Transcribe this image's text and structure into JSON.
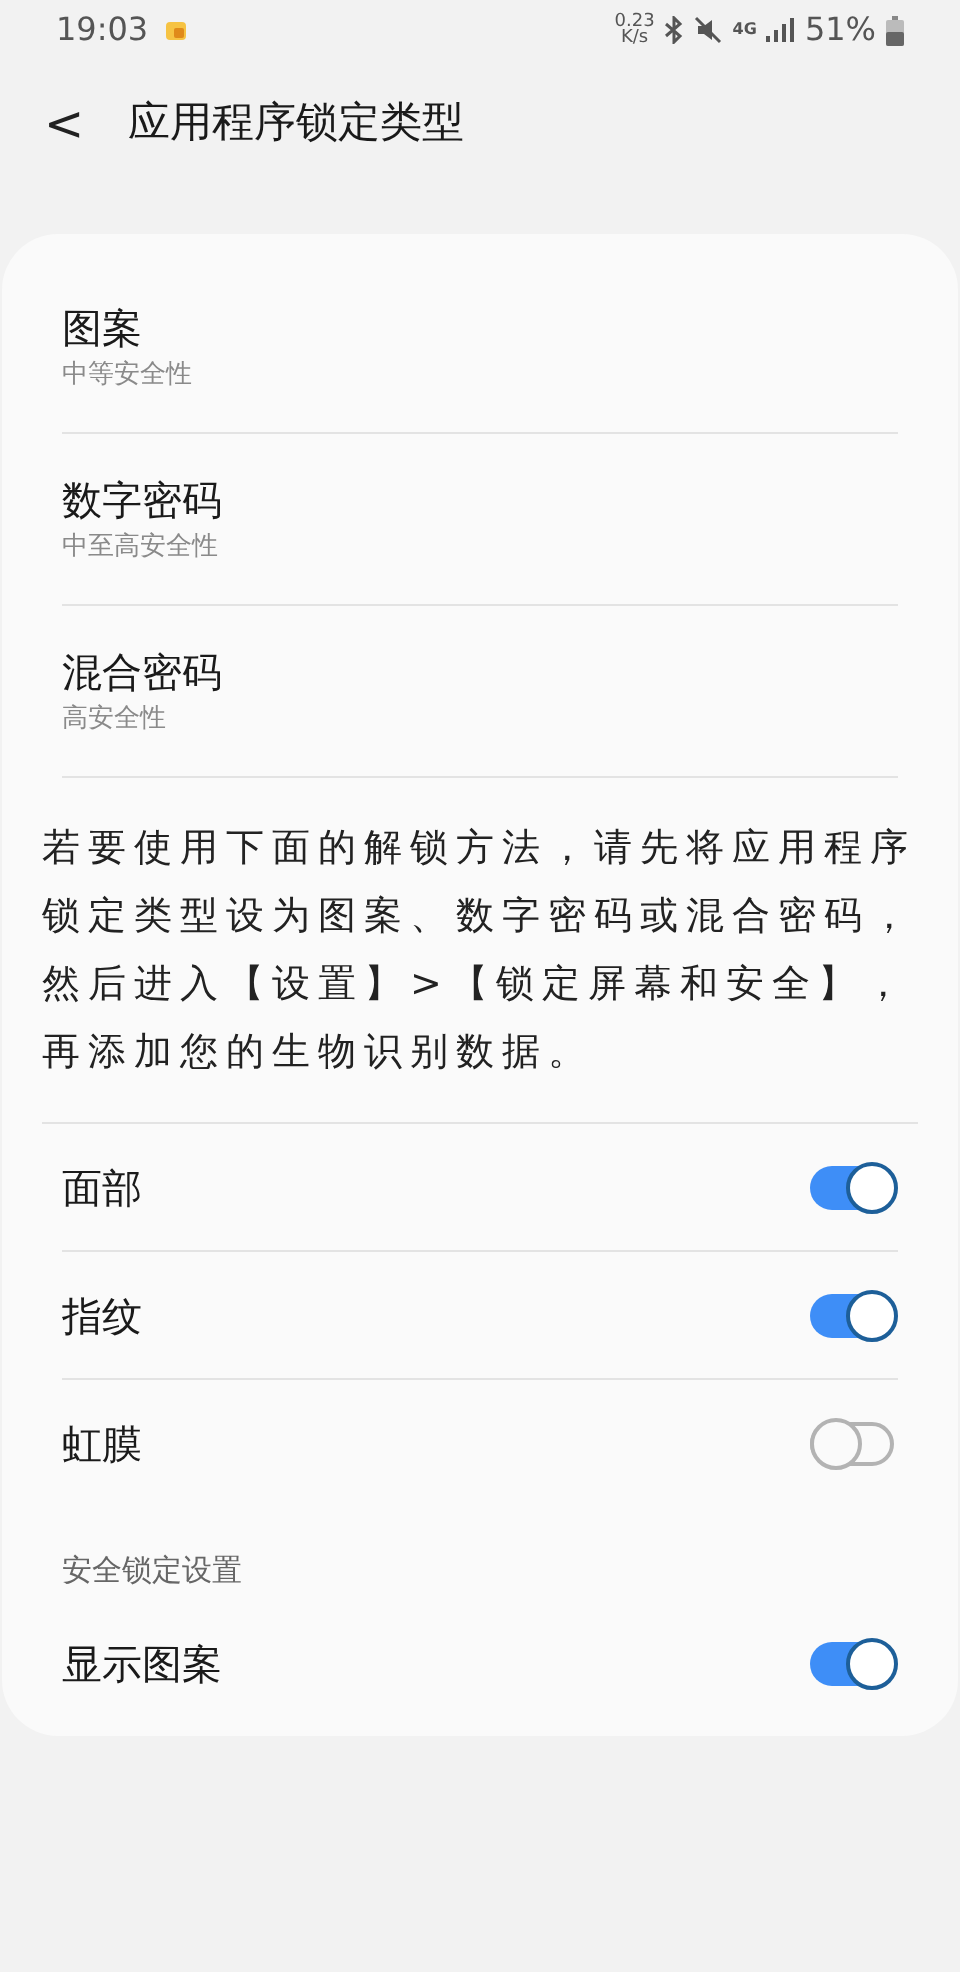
{
  "status_bar": {
    "time": "19:03",
    "speed": "0.23",
    "speed_unit": "K/s",
    "network": "4G",
    "battery": "51%"
  },
  "header": {
    "back": "<",
    "title": "应用程序锁定类型"
  },
  "lock_types": [
    {
      "title": "图案",
      "subtitle": "中等安全性"
    },
    {
      "title": "数字密码",
      "subtitle": "中至高安全性"
    },
    {
      "title": "混合密码",
      "subtitle": "高安全性"
    }
  ],
  "notice": "若要使用下面的解锁方法，请先将应用程序锁定类型设为图案、数字密码或混合密码，然后进入【设置】>【锁定屏幕和安全】，再添加您的生物识别数据。",
  "biometrics": [
    {
      "label": "面部",
      "on": true
    },
    {
      "label": "指纹",
      "on": true
    },
    {
      "label": "虹膜",
      "on": false
    }
  ],
  "section_title": "安全锁定设置",
  "secure_settings": [
    {
      "label": "显示图案",
      "on": true
    }
  ]
}
